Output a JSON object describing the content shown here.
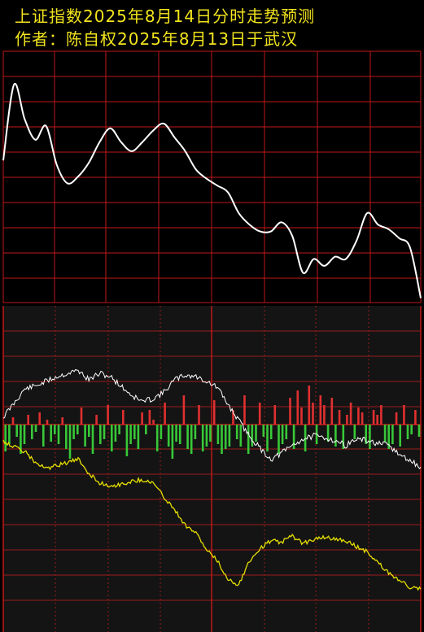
{
  "header": {
    "line1": "上证指数2025年8月14日分时走势预测",
    "line2": "作者：陈自权2025年8月13日于武汉"
  },
  "colors": {
    "background_upper": "#000000",
    "background_lower": "#141414",
    "grid_upper": "#c01818",
    "grid_lower": "#9a1c1c",
    "title_text": "#f2e41c",
    "forecast_line": "#ffffff",
    "index_line": "#ffffff",
    "avg_line": "#e6df00",
    "bar_up": "#e03030",
    "bar_down": "#38c838"
  },
  "chart_data": [
    {
      "type": "line",
      "title": "上证指数2025年8月14日分时走势预测",
      "series": [
        {
          "values": [
            62,
            95,
            80,
            71,
            77,
            60,
            52,
            55,
            61,
            70,
            76,
            70,
            66,
            70,
            75,
            78,
            72,
            66,
            58,
            54,
            51,
            48,
            39,
            34,
            31,
            31,
            35,
            29,
            13,
            19,
            16,
            20,
            19,
            27,
            39,
            34,
            32,
            28,
            24,
            2
          ]
        }
      ],
      "ylim": [
        0,
        100
      ],
      "grid": true
    },
    {
      "type": "line",
      "series": [
        {
          "values": [
            62,
            71,
            80,
            82,
            85,
            88,
            90,
            92,
            86,
            90,
            88,
            82,
            76,
            72,
            74,
            78,
            86,
            89,
            88,
            85,
            81,
            70,
            60,
            50,
            42,
            35,
            39,
            44,
            48,
            50,
            49,
            47,
            44,
            48,
            47,
            45,
            44,
            38,
            34,
            30
          ]
        },
        {
          "values": [
            47,
            43,
            40,
            33,
            29,
            31,
            33,
            35,
            26,
            20,
            18,
            19,
            21,
            22,
            20,
            11,
            3,
            -7,
            -12,
            -23,
            -30,
            -42,
            -45,
            -30,
            -22,
            -17,
            -18,
            -14,
            -19,
            -16,
            -15,
            -16,
            -17,
            -21,
            -24,
            -31,
            -38,
            -42,
            -47,
            -48
          ]
        }
      ],
      "ylim": [
        -50,
        100
      ],
      "grid": true
    },
    {
      "type": "bar",
      "ylim": [
        -100,
        100
      ],
      "values": [
        -55,
        -40,
        15,
        -25,
        -60,
        -40,
        20,
        -30,
        -15,
        25,
        -45,
        10,
        -35,
        -20,
        -40,
        15,
        -50,
        -70,
        -30,
        -20,
        35,
        -45,
        -25,
        -60,
        20,
        -40,
        -30,
        40,
        -55,
        -35,
        -20,
        30,
        -65,
        -40,
        -30,
        -50,
        25,
        -20,
        30,
        10,
        -55,
        -30,
        45,
        -45,
        -70,
        -35,
        -40,
        60,
        -50,
        -60,
        -30,
        40,
        -55,
        -45,
        -35,
        50,
        -40,
        -60,
        -50,
        -45,
        30,
        -30,
        -45,
        60,
        -60,
        -45,
        -35,
        45,
        -25,
        -55,
        -30,
        40,
        -60,
        -40,
        -30,
        55,
        -50,
        70,
        35,
        -55,
        80,
        45,
        -40,
        60,
        40,
        -35,
        55,
        -45,
        30,
        -50,
        20,
        45,
        -30,
        35,
        25,
        -40,
        -50,
        30,
        20,
        40,
        -35,
        -50,
        -40,
        25,
        -45,
        40,
        -30,
        -20,
        30,
        -25
      ]
    }
  ]
}
